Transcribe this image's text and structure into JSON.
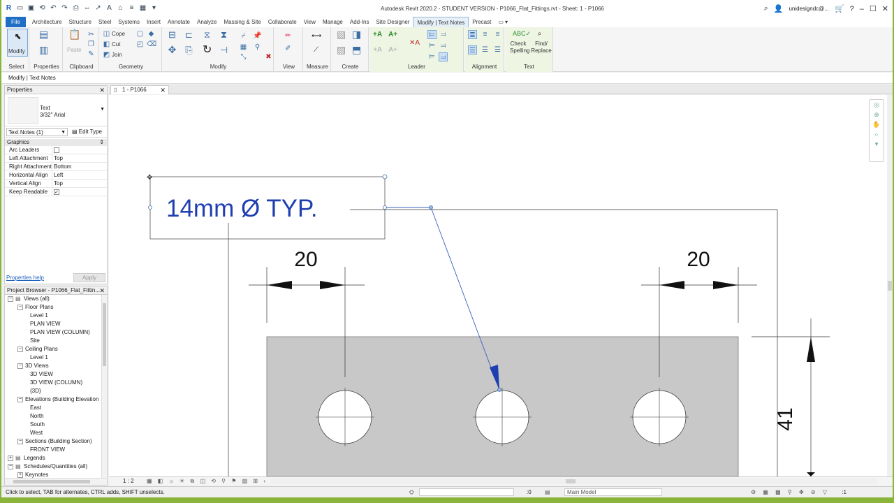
{
  "window": {
    "title": "Autodesk Revit 2020.2 - STUDENT VERSION - P1066_Flat_Fittings.rvt - Sheet: 1 - P1066",
    "user": "unidesigndc@..."
  },
  "ribbon_tabs": [
    "File",
    "Architecture",
    "Structure",
    "Steel",
    "Systems",
    "Insert",
    "Annotate",
    "Analyze",
    "Massing & Site",
    "Collaborate",
    "View",
    "Manage",
    "Add-Ins",
    "Site Designer",
    "Modify | Text Notes",
    "Precast"
  ],
  "ribbon": {
    "modify": "Modify",
    "paste": "Paste",
    "cope": "Cope",
    "cut": "Cut",
    "join": "Join",
    "check_spelling": "Check Spelling",
    "find_replace": "Find/ Replace",
    "panels": {
      "select": "Select",
      "properties": "Properties",
      "clipboard": "Clipboard",
      "geometry": "Geometry",
      "modify": "Modify",
      "view": "View",
      "measure": "Measure",
      "create": "Create",
      "leader": "Leader",
      "alignment": "Alignment",
      "text": "Text"
    }
  },
  "options_bar": "Modify | Text Notes",
  "properties": {
    "title": "Properties",
    "type_line1": "Text",
    "type_line2": "3/32\" Arial",
    "instance": "Text Notes (1)",
    "edit_type": "Edit Type",
    "group": "Graphics",
    "rows": [
      {
        "k": "Arc Leaders",
        "v": ""
      },
      {
        "k": "Left Attachment",
        "v": "Top"
      },
      {
        "k": "Right Attachment",
        "v": "Bottom"
      },
      {
        "k": "Horizontal Align",
        "v": "Left"
      },
      {
        "k": "Vertical Align",
        "v": "Top"
      },
      {
        "k": "Keep Readable",
        "v": ""
      }
    ],
    "help": "Properties help",
    "apply": "Apply"
  },
  "browser": {
    "title": "Project Browser - P1066_Flat_Fittin...",
    "nodes": [
      {
        "label": "Views (all)",
        "level": 0
      },
      {
        "label": "Floor Plans",
        "level": 1
      },
      {
        "label": "Level 1",
        "level": 2
      },
      {
        "label": "PLAN VIEW",
        "level": 2
      },
      {
        "label": "PLAN VIEW (COLUMN)",
        "level": 2
      },
      {
        "label": "Site",
        "level": 2
      },
      {
        "label": "Ceiling Plans",
        "level": 1
      },
      {
        "label": "Level 1",
        "level": 2
      },
      {
        "label": "3D Views",
        "level": 1
      },
      {
        "label": "3D VIEW",
        "level": 2
      },
      {
        "label": "3D VIEW (COLUMN)",
        "level": 2
      },
      {
        "label": "{3D}",
        "level": 2
      },
      {
        "label": "Elevations (Building Elevation",
        "level": 1
      },
      {
        "label": "East",
        "level": 2
      },
      {
        "label": "North",
        "level": 2
      },
      {
        "label": "South",
        "level": 2
      },
      {
        "label": "West",
        "level": 2
      },
      {
        "label": "Sections (Building Section)",
        "level": 1
      },
      {
        "label": "FRONT VIEW",
        "level": 2
      },
      {
        "label": "Legends",
        "level": 0
      },
      {
        "label": "Schedules/Quantities (all)",
        "level": 0
      },
      {
        "label": "Keynotes",
        "level": 1
      }
    ]
  },
  "view_tab": "1 - P1066",
  "drawing": {
    "note": "14mm Ø TYP.",
    "dim_left": "20",
    "dim_right": "20",
    "dim_vertical": "41"
  },
  "view_control": {
    "scale": "1 : 2"
  },
  "status": {
    "message": "Click to select, TAB for alternates, CTRL adds, SHIFT unselects.",
    "zero": ":0",
    "model": "Main Model",
    "filter_count": ":1"
  },
  "colors": {
    "file_tab": "#1f6fc5",
    "note_text": "#1f3fb0",
    "plate": "#c8c8c8",
    "accent_border": "#8ab53a"
  }
}
